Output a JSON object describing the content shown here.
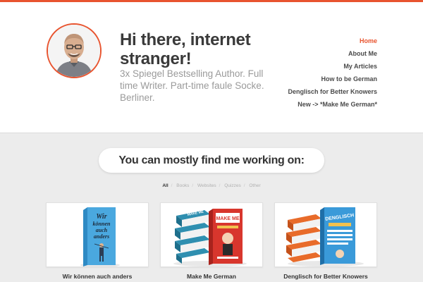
{
  "site": {
    "title": "Hi there, internet stranger!",
    "tagline": "3x Spiegel Bestselling Author. Full time Writer. Part-time faule Socke. Berliner."
  },
  "nav": {
    "items": [
      {
        "label": "Home",
        "active": true
      },
      {
        "label": "About Me",
        "active": false
      },
      {
        "label": "My Articles",
        "active": false
      },
      {
        "label": "How to be German",
        "active": false
      },
      {
        "label": "Denglisch for Better Knowers",
        "active": false
      },
      {
        "label": "New -> *Make Me German*",
        "active": false
      }
    ]
  },
  "section": {
    "heading": "You can mostly find me working on:"
  },
  "filters": [
    "All",
    "Books",
    "Websites",
    "Quizzes",
    "Other"
  ],
  "portfolio": [
    {
      "title": "Wir können auch anders",
      "cover_text": "Wir können auch anders"
    },
    {
      "title": "Make Me German",
      "cover_text": "MAKE ME GERMAN"
    },
    {
      "title": "Denglisch for Better Knowers",
      "cover_text": "DENGLISCH"
    }
  ],
  "colors": {
    "accent": "#e8542f",
    "background": "#ececec",
    "header_bg": "#ffffff",
    "text_dark": "#333333",
    "text_muted": "#9a9a9a"
  },
  "icons": {
    "avatar": "author-portrait"
  }
}
